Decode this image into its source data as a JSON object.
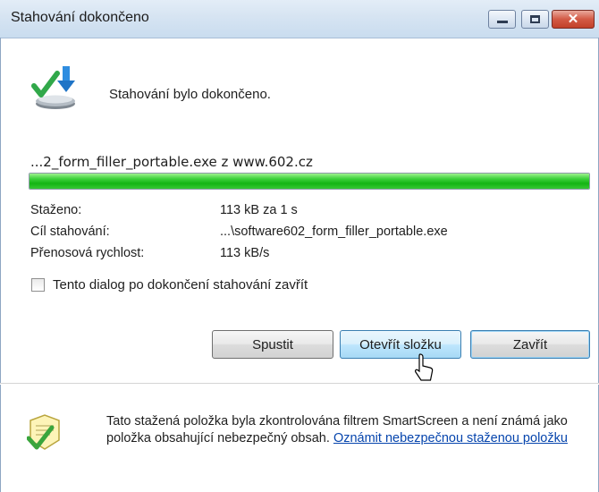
{
  "window": {
    "title": "Stahování dokončeno",
    "close_glyph": "✕"
  },
  "status": {
    "message": "Stahování bylo dokončeno."
  },
  "download": {
    "file_line": "...2_form_filler_portable.exe z www.602.cz",
    "progress_percent": 100,
    "progress_color": "#14b414"
  },
  "details": [
    {
      "label": "Staženo:",
      "value": "113 kB za 1 s"
    },
    {
      "label": "Cíl stahování:",
      "value": "...\\software602_form_filler_portable.exe"
    },
    {
      "label": "Přenosová rychlost:",
      "value": "113 kB/s"
    }
  ],
  "options": {
    "close_on_complete_label": "Tento dialog po dokončení stahování zavřít",
    "close_on_complete_checked": false
  },
  "buttons": {
    "run": "Spustit",
    "open_folder": "Otevřít složku",
    "close": "Zavřít"
  },
  "smartscreen": {
    "text": "Tato stažená položka byla zkontrolována filtrem SmartScreen a není známá jako položka obsahující nebezpečný obsah.",
    "link": "Oznámit nebezpečnou staženou položku"
  }
}
